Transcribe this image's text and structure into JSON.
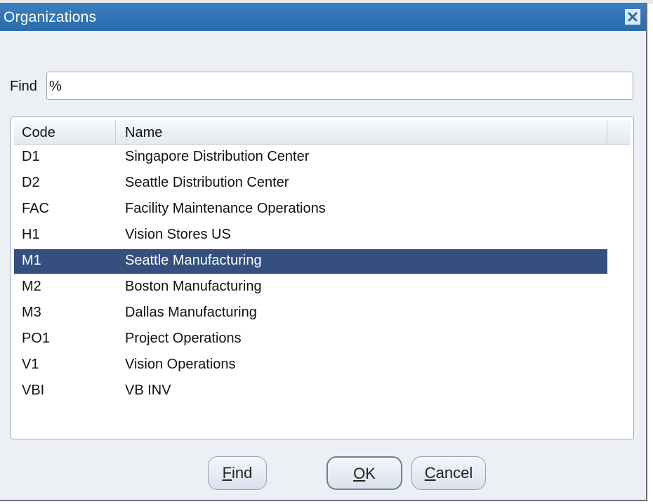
{
  "window": {
    "title": "Organizations"
  },
  "find": {
    "label": "Find",
    "value": "%"
  },
  "table": {
    "columns": [
      "Code",
      "Name"
    ],
    "selected_index": 4,
    "rows": [
      {
        "code": "D1",
        "name": "Singapore Distribution Center"
      },
      {
        "code": "D2",
        "name": "Seattle Distribution Center"
      },
      {
        "code": "FAC",
        "name": "Facility Maintenance Operations"
      },
      {
        "code": "H1",
        "name": "Vision Stores US"
      },
      {
        "code": "M1",
        "name": "Seattle Manufacturing"
      },
      {
        "code": "M2",
        "name": "Boston Manufacturing"
      },
      {
        "code": "M3",
        "name": "Dallas Manufacturing"
      },
      {
        "code": "PO1",
        "name": "Project Operations"
      },
      {
        "code": "V1",
        "name": "Vision Operations"
      },
      {
        "code": "VBI",
        "name": "VB INV"
      }
    ]
  },
  "buttons": {
    "find_mnemonic": "F",
    "find_rest": "ind",
    "ok_mnemonic": "O",
    "ok_rest": "K",
    "cancel_mnemonic": "C",
    "cancel_rest": "ancel"
  },
  "colors": {
    "titlebar": "#2a6cad",
    "selection": "#35507f"
  },
  "icons": {
    "close": "close-icon"
  }
}
